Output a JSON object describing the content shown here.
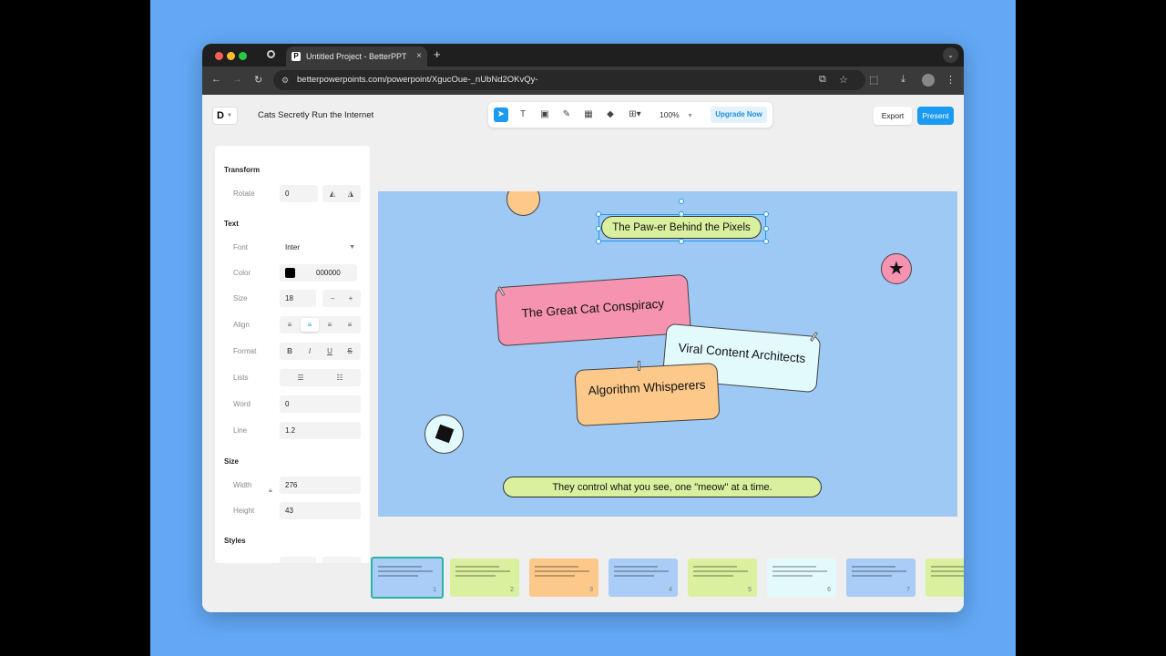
{
  "browser": {
    "tab_title": "Untitled Project - BetterPPT",
    "tab_close": "×",
    "new_tab": "+",
    "url": "betterpowerpoints.com/powerpoint/XgucOue-_nUbNd2OKvQy-"
  },
  "app": {
    "logo": "D",
    "project_title": "Cats Secretly Run the Internet",
    "zoom": "100%",
    "upgrade_label": "Upgrade Now",
    "export_label": "Export",
    "present_label": "Present"
  },
  "panel": {
    "transform": {
      "heading": "Transform",
      "rotate_label": "Rotate",
      "rotate_value": "0"
    },
    "text": {
      "heading": "Text",
      "font_label": "Font",
      "font_value": "Inter",
      "color_label": "Color",
      "color_value": "000000",
      "size_label": "Size",
      "size_value": "18",
      "align_label": "Align",
      "format_label": "Format",
      "format_bold": "B",
      "format_italic": "I",
      "format_underline": "U",
      "format_strike": "S",
      "lists_label": "Lists",
      "word_label": "Word",
      "word_value": "0",
      "line_label": "Line",
      "line_value": "1.2"
    },
    "size": {
      "heading": "Size",
      "width_label": "Width",
      "width_value": "276",
      "height_label": "Height",
      "height_value": "43"
    },
    "styles_heading": "Styles"
  },
  "slide": {
    "title": "The Paw-er Behind the Pixels",
    "card1": "The Great Cat Conspiracy",
    "card2": "Viral Content Architects",
    "card3": "Algorithm Whisperers",
    "footer": "They control what you see, one \"meow\" at a time."
  },
  "thumbnails": [
    {
      "num": "1",
      "color": "#a9cdf6"
    },
    {
      "num": "2",
      "color": "#d9f09e"
    },
    {
      "num": "3",
      "color": "#fcc98a"
    },
    {
      "num": "4",
      "color": "#a9cdf6"
    },
    {
      "num": "5",
      "color": "#d9f09e"
    },
    {
      "num": "6",
      "color": "#e3fafc"
    },
    {
      "num": "7",
      "color": "#a9cdf6"
    },
    {
      "num": "8",
      "color": "#d9f09e"
    }
  ],
  "colors": {
    "accent": "#1a9af0",
    "slide_bg": "#9ec9f5",
    "pink": "#f693b0",
    "orange": "#fcc98a",
    "green": "#d9f09e",
    "cyan": "#e3fafc"
  }
}
